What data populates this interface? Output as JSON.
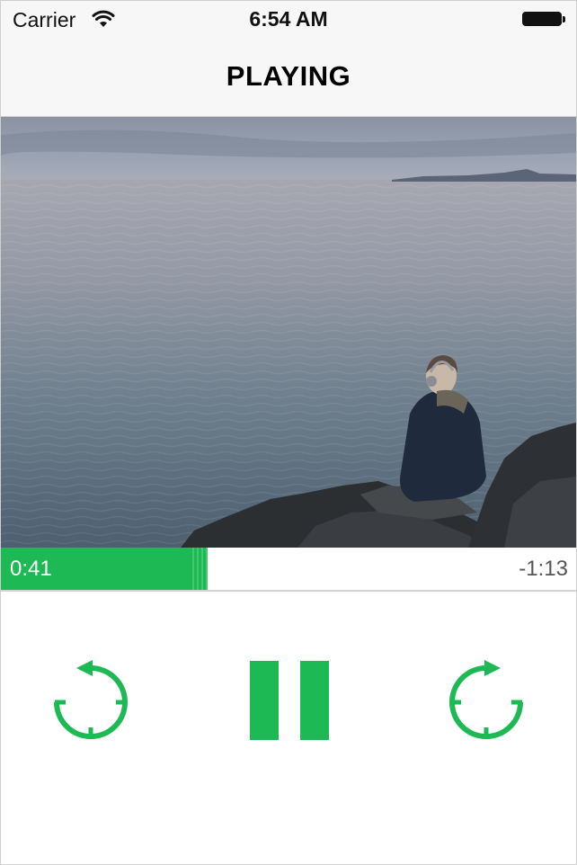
{
  "status_bar": {
    "carrier": "Carrier",
    "time": "6:54 AM"
  },
  "nav": {
    "title": "PLAYING"
  },
  "player": {
    "elapsed": "0:41",
    "remaining": "-1:13",
    "progress_fraction": 0.36
  },
  "controls": {
    "rewind_icon": "rewind-icon",
    "pause_icon": "pause-icon",
    "forward_icon": "fast-forward-icon"
  },
  "colors": {
    "accent": "#1db954",
    "status_bar_bg": "#f7f7f7"
  }
}
